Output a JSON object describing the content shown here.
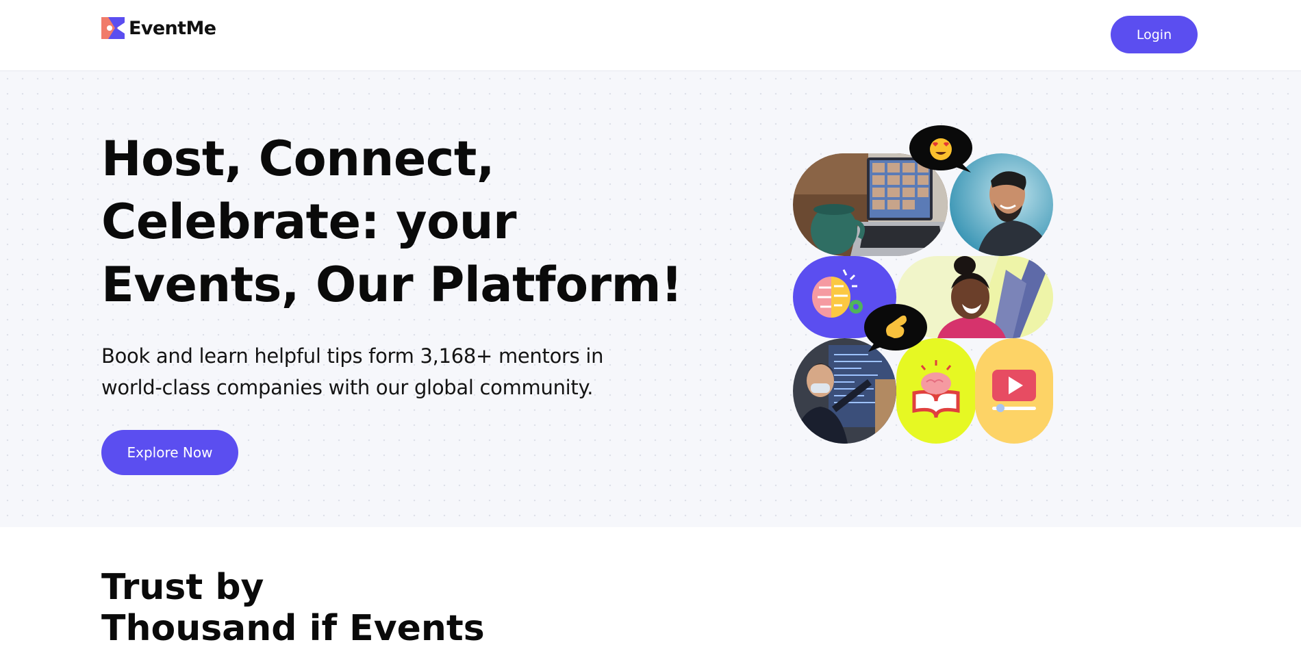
{
  "brand": {
    "name": "EventMe",
    "logo_icon": "eventme-logo-icon",
    "color": "#5b4ef0"
  },
  "nav": {
    "login_label": "Login"
  },
  "hero": {
    "title_lines": [
      "Host, Connect,",
      "Celebrate: your",
      "Events, Our Platform!"
    ],
    "subtitle_lines": [
      "Book and learn helpful tips form 3,168+ mentors in",
      "world-class companies with our global community."
    ],
    "cta_label": "Explore Now"
  },
  "collage": {
    "tiles": [
      "video-call-laptop-photo",
      "smiling-man-photo",
      "brain-lightbulb-illustration",
      "laughing-woman-photo",
      "presenter-screen-photo",
      "brain-book-illustration",
      "video-play-illustration"
    ],
    "bubbles": [
      "heart-eyes-emoji-icon",
      "pinching-hand-emoji-icon"
    ]
  },
  "trust": {
    "title_lines": [
      "Trust by",
      "Thousand if Events"
    ]
  },
  "colors": {
    "accent": "#5b4ef0",
    "hero_bg": "#f6f7fb",
    "lime": "#e6f823",
    "amber": "#fdd366"
  }
}
